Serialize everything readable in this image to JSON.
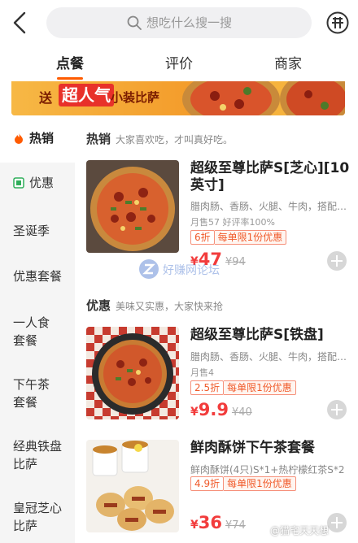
{
  "header": {
    "search_placeholder": "想吃什么搜一搜"
  },
  "tabs": [
    {
      "label": "点餐",
      "active": true
    },
    {
      "label": "评价",
      "active": false
    },
    {
      "label": "商家",
      "active": false
    }
  ],
  "banner": {
    "t1": "送",
    "t2": "超人气",
    "t3": "小装比萨"
  },
  "sidebar": [
    {
      "label": "热销",
      "icon": "flame-icon",
      "active": true
    },
    {
      "label": "优惠",
      "icon": "coupon-icon",
      "active": false
    },
    {
      "label": "圣诞季"
    },
    {
      "label": "优惠套餐"
    },
    {
      "label_lines": [
        "一人食",
        "套餐"
      ]
    },
    {
      "label_lines": [
        "下午茶",
        "套餐"
      ]
    },
    {
      "label_lines": [
        "经典铁盘",
        "比萨"
      ]
    },
    {
      "label_lines": [
        "皇冠芝心",
        "比萨"
      ]
    }
  ],
  "sections": [
    {
      "title": "热销",
      "subtitle": "大家喜欢吃，才叫真好吃。"
    },
    {
      "title": "优惠",
      "subtitle": "美味又实惠，大家快来抢"
    }
  ],
  "items": [
    {
      "name": "超级至尊比萨S[芝心][10英寸]",
      "desc": "腊肉肠、香肠、火腿、牛肉，搭配…",
      "sales": "月售57  好评率100%",
      "discount": "6折",
      "limit": "每单限1份优惠",
      "price_symbol": "¥",
      "price": "47",
      "orig_price": "¥94"
    },
    {
      "name": "超级至尊比萨S[铁盘]",
      "desc": "腊肉肠、香肠、火腿、牛肉，搭配…",
      "sales": "月售4",
      "discount": "2.5折",
      "limit": "每单限1份优惠",
      "price_symbol": "¥",
      "price": "9.9",
      "orig_price": "¥40"
    },
    {
      "name": "鲜肉酥饼下午茶套餐",
      "desc": "鲜肉酥饼(4只)S*1+热柠檬红茶S*2",
      "discount": "4.9折",
      "limit": "每单限1份优惠",
      "price_symbol": "¥",
      "price": "36",
      "orig_price": "¥74"
    }
  ],
  "watermark": "好赚网论坛",
  "credit": "@猫宅天天想",
  "colors": {
    "accent": "#ff5b00",
    "price": "#f23c3c",
    "promo": "#f05a2a"
  }
}
